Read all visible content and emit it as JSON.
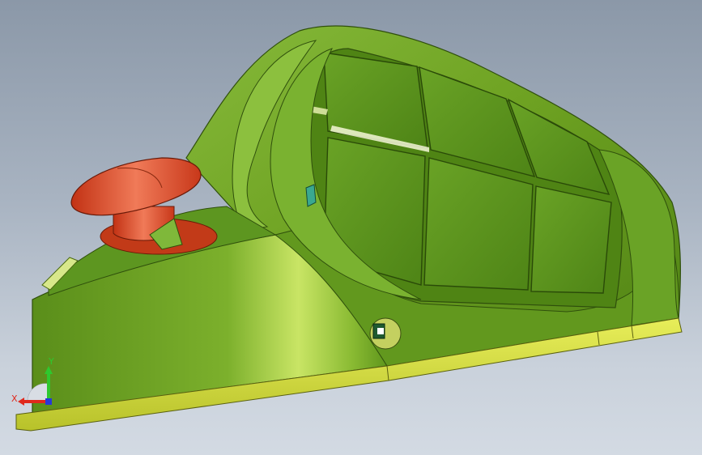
{
  "viewport": {
    "background_top": "#8b98a8",
    "background_bottom": "#d3dae3"
  },
  "model": {
    "body_color": "#6ea222",
    "body_highlight": "#c7e25c",
    "body_shadow": "#3f6a10",
    "rim_color": "#d8e23a",
    "knob_color": "#d8401c",
    "knob_highlight": "#f07a58",
    "panel_color": "#5f9420"
  },
  "triad": {
    "x_label": "X",
    "y_label": "Y",
    "x_color": "#e0281c",
    "y_color": "#2ec82e",
    "z_color": "#2838d8"
  }
}
